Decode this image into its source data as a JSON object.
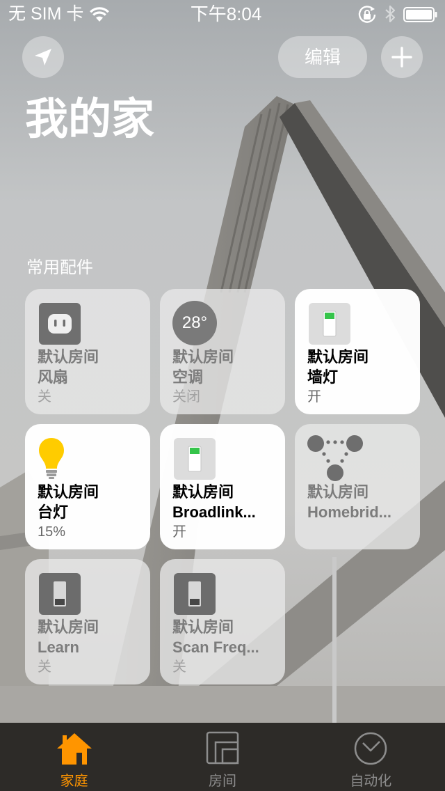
{
  "status_bar": {
    "carrier": "无 SIM 卡",
    "time": "下午8:04",
    "icons": [
      "wifi-icon",
      "rotation-lock-icon",
      "bluetooth-icon",
      "battery-icon"
    ]
  },
  "header": {
    "location_icon": "location-arrow-icon",
    "edit_label": "编辑",
    "add_icon": "plus-icon",
    "title": "我的家"
  },
  "favorites": {
    "heading": "常用配件",
    "tiles": [
      {
        "icon": "outlet-icon",
        "room": "默认房间",
        "name": "风扇",
        "status": "关",
        "on": false
      },
      {
        "icon": "thermostat-icon",
        "temperature": "28°",
        "room": "默认房间",
        "name": "空调",
        "status": "关闭",
        "on": false
      },
      {
        "icon": "switch-icon",
        "room": "默认房间",
        "name": "墙灯",
        "status": "开",
        "on": true
      },
      {
        "icon": "lightbulb-icon",
        "room": "默认房间",
        "name": "台灯",
        "status": "15%",
        "on": true
      },
      {
        "icon": "switch-icon",
        "room": "默认房间",
        "name": "Broadlink...",
        "status": "开",
        "on": true
      },
      {
        "icon": "bridge-icon",
        "room": "默认房间",
        "name": "Homebrid...",
        "on": false
      },
      {
        "icon": "switch-icon",
        "room": "默认房间",
        "name": "Learn",
        "status": "关",
        "on": false
      },
      {
        "icon": "switch-icon",
        "room": "默认房间",
        "name": "Scan Freq...",
        "status": "关",
        "on": false
      }
    ]
  },
  "tab_bar": {
    "tabs": [
      {
        "label": "家庭",
        "icon": "house-icon",
        "selected": true
      },
      {
        "label": "房间",
        "icon": "rooms-icon",
        "selected": false
      },
      {
        "label": "自动化",
        "icon": "clock-icon",
        "selected": false
      }
    ]
  },
  "colors": {
    "accent": "#ff9500",
    "switch_on": "#35c44a",
    "bulb": "#ffcc00",
    "tab_bar": "#2d2b28"
  }
}
